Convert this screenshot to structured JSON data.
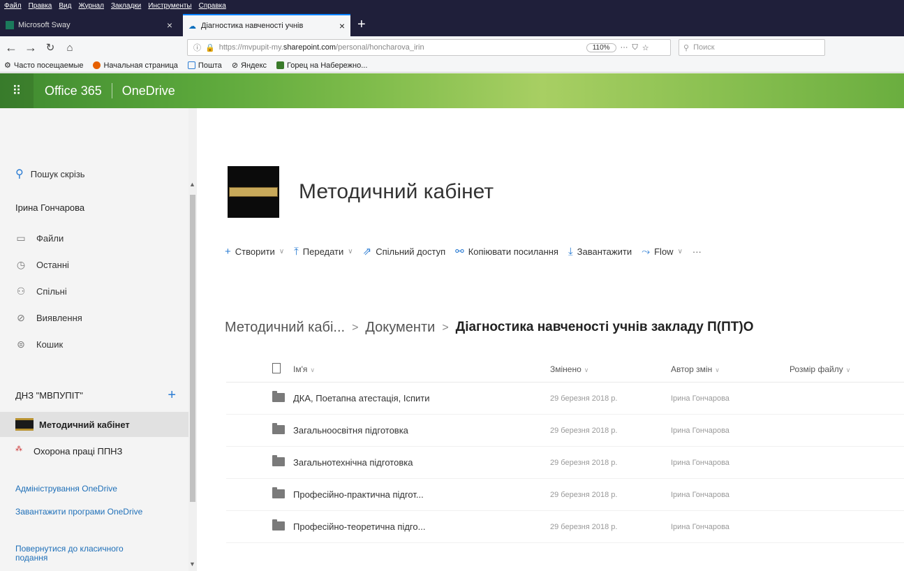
{
  "browser": {
    "menu": [
      "Файл",
      "Правка",
      "Вид",
      "Журнал",
      "Закладки",
      "Инструменты",
      "Справка"
    ],
    "tabs": [
      {
        "title": "Microsoft Sway"
      },
      {
        "title": "Діагностика навченості учнів"
      }
    ],
    "url_prefix": "https://mvpupit-my.",
    "url_domain": "sharepoint.com",
    "url_suffix": "/personal/honcharova_irin",
    "zoom": "110%",
    "search_placeholder": "Поиск",
    "bookmarks": [
      "Часто посещаемые",
      "Начальная страница",
      "Пошта",
      "Яндекс",
      "Горец на Набережно..."
    ]
  },
  "suite": {
    "brand": "Office 365",
    "app": "OneDrive"
  },
  "sidebar": {
    "search": "Пошук скрізь",
    "user": "Ірина Гончарова",
    "items": [
      {
        "label": "Файли"
      },
      {
        "label": "Останні"
      },
      {
        "label": "Спільні"
      },
      {
        "label": "Виявлення"
      },
      {
        "label": "Кошик"
      }
    ],
    "group": "ДНЗ \"МВПУПІТ\"",
    "sites": [
      {
        "label": "Методичний кабінет"
      },
      {
        "label": "Охорона праці ППНЗ"
      }
    ],
    "links": [
      "Адміністрування OneDrive",
      "Завантажити програми OneDrive",
      "Повернутися до класичного подання"
    ]
  },
  "main": {
    "site_title": "Методичний кабінет",
    "commands": [
      {
        "label": "Створити"
      },
      {
        "label": "Передати"
      },
      {
        "label": "Спільний доступ"
      },
      {
        "label": "Копіювати посилання"
      },
      {
        "label": "Завантажити"
      },
      {
        "label": "Flow"
      }
    ],
    "more": "···",
    "breadcrumb": [
      "Методичний кабі...",
      "Документи",
      "Діагностика навченості учнів закладу П(ПТ)О"
    ],
    "columns": {
      "name": "Ім'я",
      "modified": "Змінено",
      "modified_by": "Автор змін",
      "size": "Розмір файлу"
    },
    "rows": [
      {
        "name": "ДКА, Поетапна атестація, Іспити",
        "modified": "29 березня 2018 р.",
        "by": "Ірина Гончарова"
      },
      {
        "name": "Загальноосвітня підготовка",
        "modified": "29 березня 2018 р.",
        "by": "Ірина Гончарова"
      },
      {
        "name": "Загальнотехнічна підготовка",
        "modified": "29 березня 2018 р.",
        "by": "Ірина Гончарова"
      },
      {
        "name": "Професійно-практична підгот...",
        "modified": "29 березня 2018 р.",
        "by": "Ірина Гончарова"
      },
      {
        "name": "Професійно-теоретична підго...",
        "modified": "29 березня 2018 р.",
        "by": "Ірина Гончарова"
      }
    ]
  }
}
